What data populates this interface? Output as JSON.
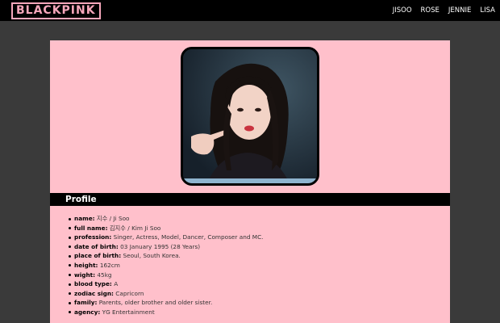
{
  "header": {
    "logo": "BLACKPINK",
    "nav": [
      "JISOO",
      "ROSE",
      "JENNIE",
      "LISA"
    ]
  },
  "profile": {
    "photo_alt": "Jisoo photo",
    "section_title": "Profile",
    "fields": [
      {
        "label": "name:",
        "value": "지수 / Ji Soo"
      },
      {
        "label": "full name:",
        "value": "김지수 / Kim Ji Soo"
      },
      {
        "label": "profession:",
        "value": "Singer, Actress, Model, Dancer, Composer and MC."
      },
      {
        "label": "date of birth:",
        "value": "03 January 1995 (28 Years)"
      },
      {
        "label": "place of birth:",
        "value": "Seoul, South Korea."
      },
      {
        "label": "height:",
        "value": "162cm"
      },
      {
        "label": "wight:",
        "value": "45kg"
      },
      {
        "label": "blood type:",
        "value": "A"
      },
      {
        "label": "zodiac sign:",
        "value": "Capricorn"
      },
      {
        "label": "family:",
        "value": "Parents, older brother and older sister."
      },
      {
        "label": "agency:",
        "value": "YG Entertainment"
      }
    ]
  },
  "colors": {
    "topbar": "#000000",
    "logo_pink": "#f7a7bb",
    "page_bg": "#3a3a3a",
    "card_bg": "#ffc0cb",
    "section_bar": "#000000"
  }
}
